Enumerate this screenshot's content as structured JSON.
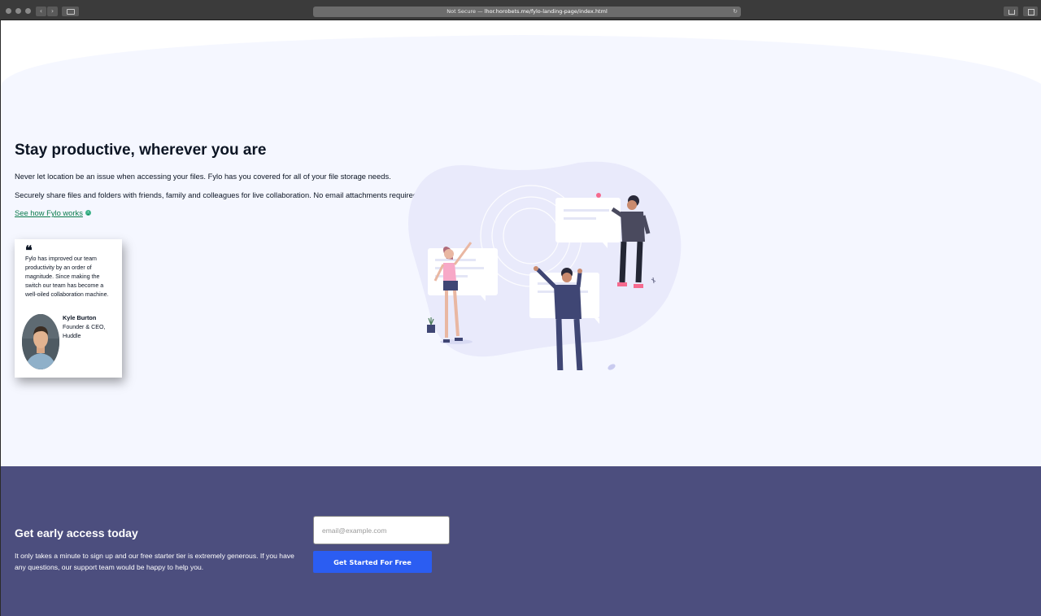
{
  "browser": {
    "url_prefix": "Not Secure — ",
    "url_host": "lhor.horobets.me/fylo-landing-page/index.html",
    "back_icon": "chevron-left-icon",
    "forward_icon": "chevron-right-icon",
    "reload_icon": "reload-icon"
  },
  "hero": {
    "title": "Stay productive, wherever you are",
    "paragraph1": "Never let location be an issue when accessing your files. Fylo has you covered for all of your file storage needs.",
    "paragraph2": "Securely share files and folders with friends, family and colleagues for live collaboration. No email attachments required!",
    "link_label": "See how Fylo works",
    "link_icon": "arrow-right-circle-icon",
    "bg_color": "#f5f7ff",
    "link_color": "#0a7a4a"
  },
  "testimonial": {
    "quote_icon": "quote-icon",
    "text": "Fylo has improved our team productivity by an order of magnitude. Since making the switch our team has become a well-oiled collaboration machine.",
    "name": "Kyle Burton",
    "role": "Founder & CEO, Huddle"
  },
  "cta": {
    "title": "Get early access today",
    "text": "It only takes a minute to sign up and our free starter tier is extremely generous. If you have any questions, our support team would be happy to help you.",
    "email_placeholder": "email@example.com",
    "button_label": "Get Started For Free",
    "bg_color": "#4c4e7e",
    "button_color": "#2b5df2"
  }
}
